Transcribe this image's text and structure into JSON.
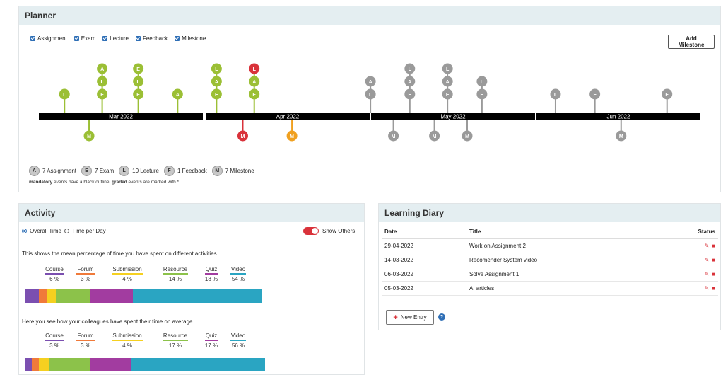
{
  "planner": {
    "title": "Planner",
    "filters": [
      "Assignment",
      "Exam",
      "Lecture",
      "Feedback",
      "Milestone"
    ],
    "add_milestone_label": "Add Milestone",
    "months": [
      "Mar 2022",
      "Apr 2022",
      "May 2022",
      "Jun 2022"
    ],
    "colors": {
      "green": "#9bbf35",
      "red": "#d9323a",
      "orange": "#f0a020",
      "gray": "#9a9a9a",
      "axis": "#000000"
    },
    "legend": [
      {
        "letter": "A",
        "label": "7 Assignment"
      },
      {
        "letter": "E",
        "label": "7 Exam"
      },
      {
        "letter": "L",
        "label": "10 Lecture"
      },
      {
        "letter": "F",
        "label": "1 Feedback"
      },
      {
        "letter": "M",
        "label": "7 Milestone"
      }
    ],
    "legend_note": {
      "mandatory": "mandatory",
      "mid": " events have a black outline, ",
      "graded": "graded",
      "end": " events are marked with *"
    },
    "events_above": [
      {
        "month": 0,
        "day": 0.07,
        "stack": [
          "L"
        ],
        "color": "green"
      },
      {
        "month": 0,
        "day": 0.3,
        "stack": [
          "A",
          "L",
          "E"
        ],
        "color": "green"
      },
      {
        "month": 0,
        "day": 0.52,
        "stack": [
          "E",
          "L",
          "E"
        ],
        "color": "green"
      },
      {
        "month": 0,
        "day": 0.76,
        "stack": [
          "A"
        ],
        "color": "green"
      },
      {
        "month": 1,
        "day": -0.02,
        "stack": [
          "L",
          "A",
          "E"
        ],
        "color": "green"
      },
      {
        "month": 1,
        "day": 0.21,
        "stack": [
          "L",
          "A",
          "E"
        ],
        "color": "red-top"
      },
      {
        "month": 2,
        "day": -0.09,
        "stack": [
          "A",
          "L"
        ],
        "color": "gray"
      },
      {
        "month": 2,
        "day": 0.15,
        "stack": [
          "L",
          "A",
          "E"
        ],
        "color": "gray"
      },
      {
        "month": 2,
        "day": 0.38,
        "stack": [
          "L",
          "A",
          "E"
        ],
        "color": "gray"
      },
      {
        "month": 2,
        "day": 0.59,
        "stack": [
          "L",
          "E"
        ],
        "color": "gray"
      },
      {
        "month": 3,
        "day": 0.03,
        "stack": [
          "L"
        ],
        "color": "gray"
      },
      {
        "month": 3,
        "day": 0.27,
        "stack": [
          "F"
        ],
        "color": "gray"
      },
      {
        "month": 3,
        "day": 0.71,
        "stack": [
          "E"
        ],
        "color": "gray"
      }
    ],
    "events_below": [
      {
        "month": 0,
        "day": 0.22,
        "letter": "M",
        "color": "green"
      },
      {
        "month": 1,
        "day": 0.14,
        "letter": "M",
        "color": "red"
      },
      {
        "month": 1,
        "day": 0.44,
        "letter": "M",
        "color": "orange"
      },
      {
        "month": 2,
        "day": 0.05,
        "letter": "M",
        "color": "gray"
      },
      {
        "month": 2,
        "day": 0.3,
        "letter": "M",
        "color": "gray"
      },
      {
        "month": 2,
        "day": 0.5,
        "letter": "M",
        "color": "gray"
      },
      {
        "month": 3,
        "day": 0.43,
        "letter": "M",
        "color": "gray"
      }
    ]
  },
  "activity": {
    "title": "Activity",
    "radio_overall": "Overall Time",
    "radio_per_day": "Time per Day",
    "toggle_label": "Show Others",
    "you_desc": "This shows the mean percentage of time you have spent on different activities.",
    "others_desc": "Here you see how your colleagues have spent their time on average.",
    "categories": [
      {
        "name": "Course",
        "color": "#7b4fb0"
      },
      {
        "name": "Forum",
        "color": "#f07a3a"
      },
      {
        "name": "Submission",
        "color": "#f5d020"
      },
      {
        "name": "Resource",
        "color": "#8cc24a"
      },
      {
        "name": "Quiz",
        "color": "#a23ca0"
      },
      {
        "name": "Video",
        "color": "#2aa5c2"
      }
    ],
    "you_values": [
      6,
      3,
      4,
      14,
      18,
      54
    ],
    "others_values": [
      3,
      3,
      4,
      17,
      17,
      56
    ]
  },
  "diary": {
    "title": "Learning Diary",
    "headers": {
      "date": "Date",
      "title": "Title",
      "status": "Status"
    },
    "rows": [
      {
        "date": "29-04-2022",
        "title": "Work on Assignment 2"
      },
      {
        "date": "14-03-2022",
        "title": "Recomender System video"
      },
      {
        "date": "06-03-2022",
        "title": "Solve Assignment 1"
      },
      {
        "date": "05-03-2022",
        "title": "AI articles"
      }
    ],
    "new_entry_label": "New Entry",
    "edit_icon": "pencil-icon",
    "delete_icon": "trash-icon"
  }
}
